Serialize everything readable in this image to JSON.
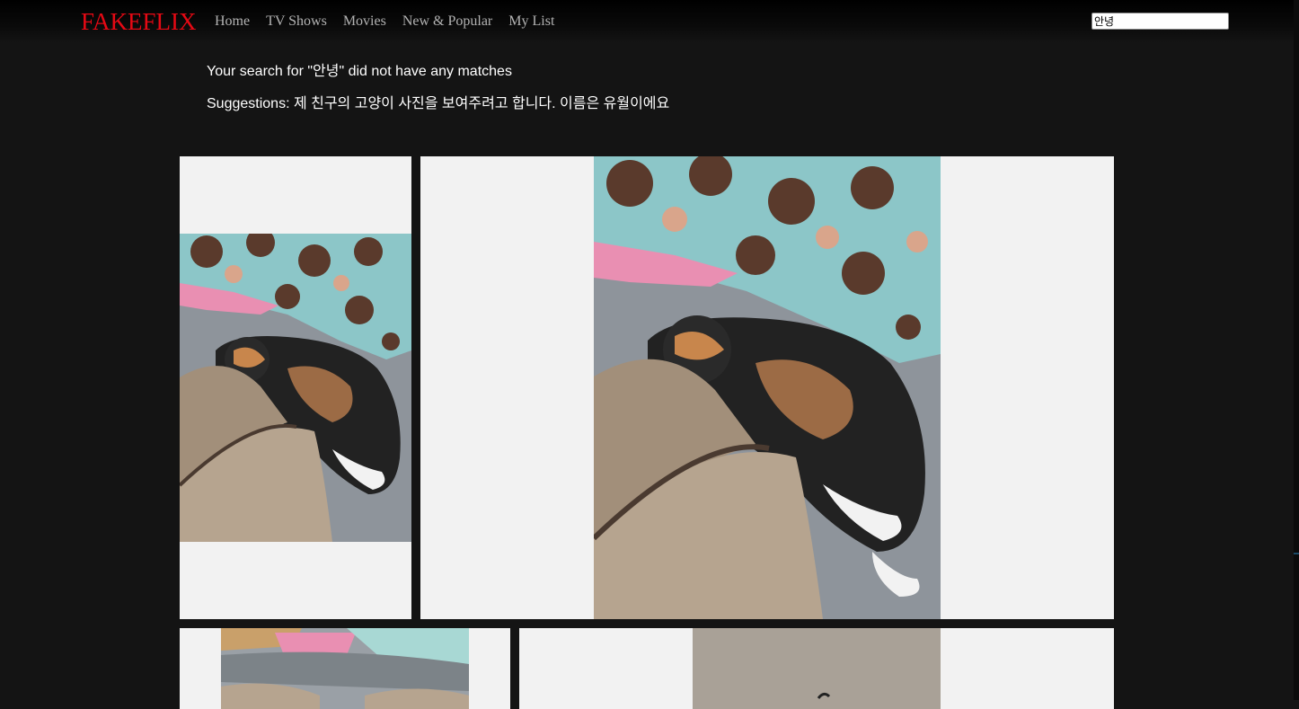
{
  "app": {
    "logo": "FAKEFLIX"
  },
  "nav": {
    "items": [
      {
        "label": "Home"
      },
      {
        "label": "TV Shows"
      },
      {
        "label": "Movies"
      },
      {
        "label": "New & Popular"
      },
      {
        "label": "My List"
      }
    ]
  },
  "search": {
    "value": "안녕"
  },
  "results": {
    "no_match_text": "Your search for \"안녕\" did not have any matches",
    "suggestions_text": "Suggestions: 제 친구의 고양이 사진을 보여주려고 합니다. 이름은 유월이에요"
  },
  "colors": {
    "background": "#141414",
    "brand": "#e50914",
    "nav_text": "#b3b3b3",
    "tile_background": "#f2f2f2"
  }
}
